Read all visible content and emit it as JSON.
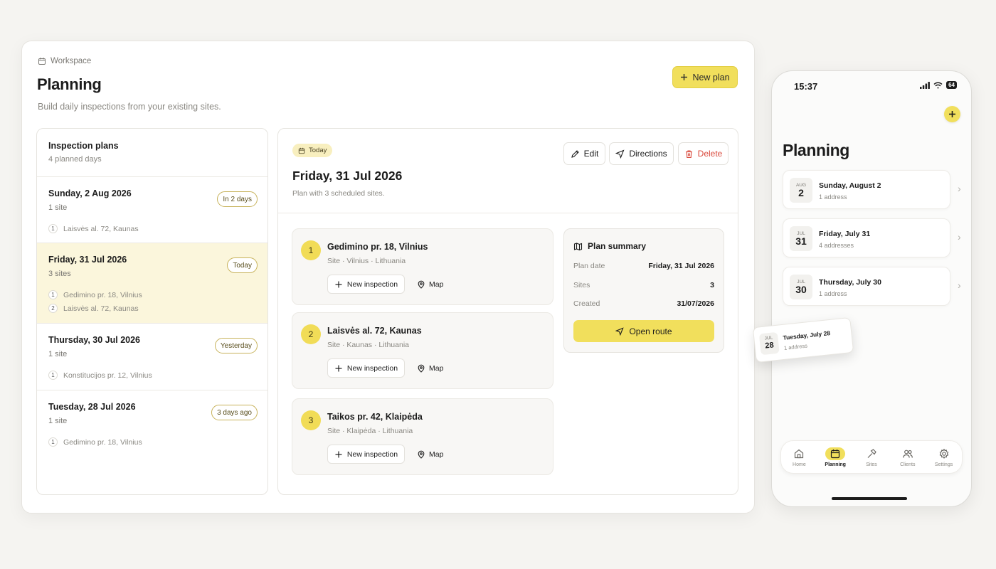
{
  "desktop": {
    "breadcrumb": "Workspace",
    "title": "Planning",
    "subtitle": "Build daily inspections from your existing sites.",
    "new_plan_label": "New plan",
    "plans_panel": {
      "title": "Inspection plans",
      "count": "4 planned days",
      "items": [
        {
          "date": "Sunday, 2 Aug 2026",
          "sites": "1 site",
          "badge": "In 2 days",
          "addresses": [
            {
              "n": "1",
              "text": "Laisvės al. 72, Kaunas"
            }
          ]
        },
        {
          "date": "Friday, 31 Jul 2026",
          "sites": "3 sites",
          "badge": "Today",
          "addresses": [
            {
              "n": "1",
              "text": "Gedimino pr. 18, Vilnius"
            },
            {
              "n": "2",
              "text": "Laisvės al. 72, Kaunas"
            }
          ]
        },
        {
          "date": "Thursday, 30 Jul 2026",
          "sites": "1 site",
          "badge": "Yesterday",
          "addresses": [
            {
              "n": "1",
              "text": "Konstitucijos pr. 12, Vilnius"
            }
          ]
        },
        {
          "date": "Tuesday, 28 Jul 2026",
          "sites": "1 site",
          "badge": "3 days ago",
          "addresses": [
            {
              "n": "1",
              "text": "Gedimino pr. 18, Vilnius"
            }
          ]
        }
      ]
    },
    "detail": {
      "chip": "Today",
      "title": "Friday, 31 Jul 2026",
      "subtitle": "Plan with 3 scheduled sites.",
      "actions": {
        "edit": "Edit",
        "directions": "Directions",
        "delete": "Delete"
      },
      "sites": [
        {
          "n": "1",
          "name": "Gedimino pr. 18, Vilnius",
          "meta": "Site · Vilnius · Lithuania",
          "new_inspection": "New inspection",
          "map": "Map"
        },
        {
          "n": "2",
          "name": "Laisvės al. 72, Kaunas",
          "meta": "Site · Kaunas · Lithuania",
          "new_inspection": "New inspection",
          "map": "Map"
        },
        {
          "n": "3",
          "name": "Taikos pr. 42, Klaipėda",
          "meta": "Site · Klaipėda · Lithuania",
          "new_inspection": "New inspection",
          "map": "Map"
        }
      ],
      "summary": {
        "title": "Plan summary",
        "rows": [
          {
            "label": "Plan date",
            "value": "Friday, 31 Jul 2026"
          },
          {
            "label": "Sites",
            "value": "3"
          },
          {
            "label": "Created",
            "value": "31/07/2026"
          }
        ],
        "open_route": "Open route"
      }
    }
  },
  "phone": {
    "time": "15:37",
    "battery": "64",
    "title": "Planning",
    "cards": [
      {
        "month": "AUG",
        "day": "2",
        "title": "Sunday, August 2",
        "sub": "1 address"
      },
      {
        "month": "JUL",
        "day": "31",
        "title": "Friday, July 31",
        "sub": "4 addresses"
      },
      {
        "month": "JUL",
        "day": "30",
        "title": "Thursday, July 30",
        "sub": "1 address"
      }
    ],
    "dragging_card": {
      "month": "JUL",
      "day": "28",
      "title": "Tuesday, July 28",
      "sub": "1 address"
    },
    "tabs": [
      "Home",
      "Planning",
      "Sites",
      "Clients",
      "Settings"
    ],
    "active_tab": "Planning"
  },
  "colors": {
    "accent": "#f1df5c",
    "danger": "#d9483b",
    "active_row": "#fbf6dc"
  }
}
